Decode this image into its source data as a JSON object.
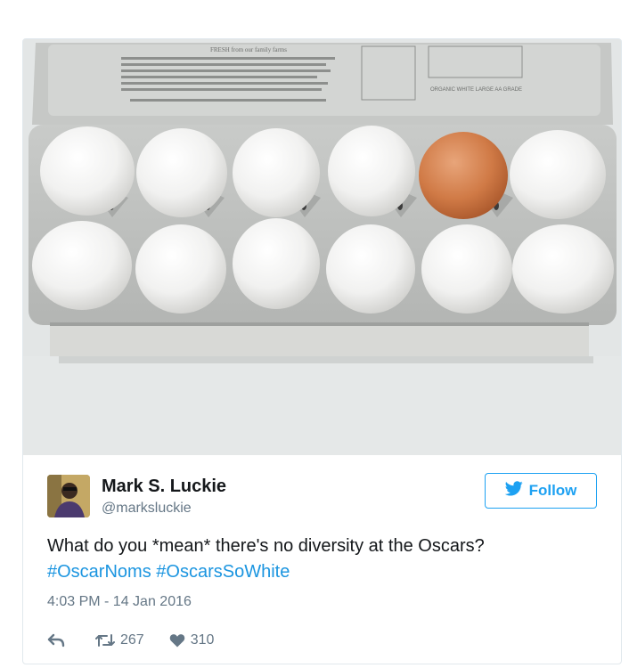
{
  "tweet": {
    "display_name": "Mark S. Luckie",
    "handle": "@marksluckie",
    "follow_label": "Follow",
    "text_before": "What do you *mean* there's no diversity at the Oscars?",
    "hashtags": [
      "#OscarNoms",
      "#OscarsSoWhite"
    ],
    "timestamp": "4:03 PM - 14 Jan 2016",
    "retweet_count": "267",
    "like_count": "310"
  },
  "media": {
    "description_icons": [
      "egg-carton-image"
    ],
    "carton_text_left": "FRESH from our family farms",
    "carton_text_right": "ORGANIC WHITE LARGE AA GRADE"
  },
  "icons": {
    "reply": "reply-icon",
    "retweet": "retweet-icon",
    "like": "heart-icon",
    "follow": "twitter-bird-icon"
  },
  "colors": {
    "accent": "#1da1f2",
    "hashtag": "#1b95e0",
    "muted": "#657786",
    "text": "#14171a",
    "brown_egg": "#d07a46"
  }
}
